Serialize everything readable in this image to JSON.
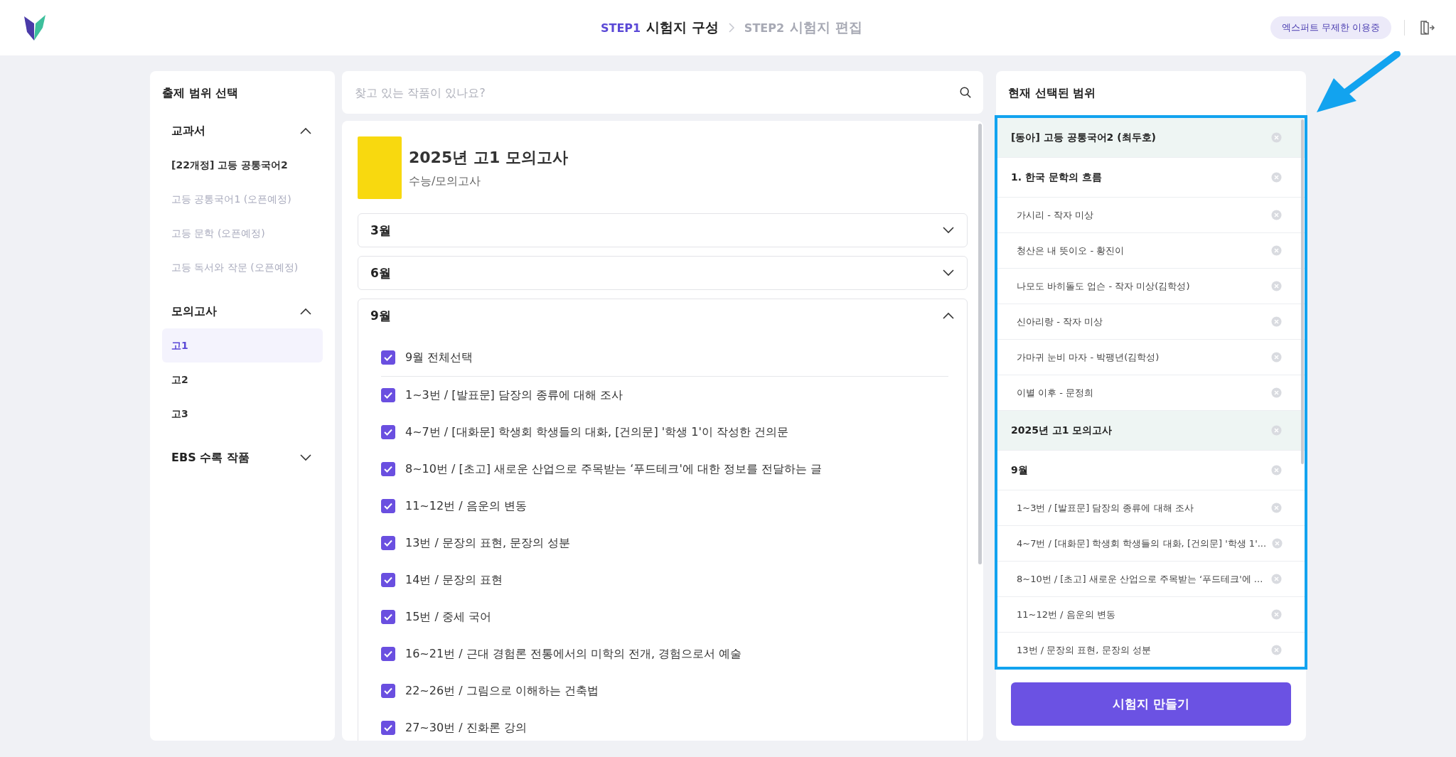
{
  "header": {
    "steps": [
      {
        "number": "STEP1",
        "label": "시험지 구성",
        "selected": true
      },
      {
        "number": "STEP2",
        "label": "시험지 편집",
        "selected": false
      }
    ],
    "badge": "엑스퍼트 무제한 이용중"
  },
  "sidebar": {
    "title": "출제 범위 선택",
    "sections": [
      {
        "title": "교과서",
        "expanded": true,
        "items": [
          {
            "label": "[22개정] 고등 공통국어2",
            "disabled": false,
            "selected": false
          },
          {
            "label": "고등 공통국어1 (오픈예정)",
            "disabled": true,
            "selected": false
          },
          {
            "label": "고등 문학 (오픈예정)",
            "disabled": true,
            "selected": false
          },
          {
            "label": "고등 독서와 작문 (오픈예정)",
            "disabled": true,
            "selected": false
          }
        ]
      },
      {
        "title": "모의고사",
        "expanded": true,
        "items": [
          {
            "label": "고1",
            "disabled": false,
            "selected": true
          },
          {
            "label": "고2",
            "disabled": false,
            "selected": false
          },
          {
            "label": "고3",
            "disabled": false,
            "selected": false
          }
        ]
      },
      {
        "title": "EBS 수록 작품",
        "expanded": false
      }
    ]
  },
  "search": {
    "placeholder": "찾고 있는 작품이 있나요?"
  },
  "exam": {
    "title": "2025년 고1 모의고사",
    "subtitle": "수능/모의고사",
    "months": [
      {
        "label": "3월",
        "expanded": false
      },
      {
        "label": "6월",
        "expanded": false
      },
      {
        "label": "9월",
        "expanded": true,
        "select_all": {
          "label": "9월 전체선택",
          "checked": true
        },
        "items": [
          {
            "label": "1~3번 / [발표문] 담장의 종류에 대해 조사",
            "checked": true
          },
          {
            "label": "4~7번 / [대화문] 학생회 학생들의 대화, [건의문] '학생 1'이 작성한 건의문",
            "checked": true
          },
          {
            "label": "8~10번 / [초고] 새로운 산업으로 주목받는 ‘푸드테크'에 대한 정보를 전달하는 글",
            "checked": true
          },
          {
            "label": "11~12번 / 음운의 변동",
            "checked": true
          },
          {
            "label": "13번 / 문장의 표현, 문장의 성분",
            "checked": true
          },
          {
            "label": "14번 / 문장의 표현",
            "checked": true
          },
          {
            "label": "15번 / 중세 국어",
            "checked": true
          },
          {
            "label": "16~21번 / 근대 경험론 전통에서의 미학의 전개, 경험으로서 예술",
            "checked": true
          },
          {
            "label": "22~26번 / 그림으로 이해하는 건축법",
            "checked": true
          },
          {
            "label": "27~30번 / 진화론 강의",
            "checked": true
          }
        ]
      }
    ]
  },
  "selection": {
    "title": "현재 선택된 범위",
    "items": [
      {
        "kind": "group",
        "label": "[동아] 고등 공통국어2 (최두호)"
      },
      {
        "kind": "section",
        "label": "1. 한국 문학의 흐름"
      },
      {
        "kind": "item",
        "label": "가시리 - 작자 미상"
      },
      {
        "kind": "item",
        "label": "청산은 내 뜻이오 - 황진이"
      },
      {
        "kind": "item",
        "label": "나모도 바히돌도 업슨 - 작자 미상(김학성)"
      },
      {
        "kind": "item",
        "label": "신아리랑 - 작자 미상"
      },
      {
        "kind": "item",
        "label": "가마귀 눈비 마자 - 박팽년(김학성)"
      },
      {
        "kind": "item",
        "label": "이별 이후 - 문정희"
      },
      {
        "kind": "group",
        "label": "2025년 고1 모의고사"
      },
      {
        "kind": "section",
        "label": "9월"
      },
      {
        "kind": "item",
        "label": "1~3번 / [발표문] 담장의 종류에 대해 조사"
      },
      {
        "kind": "item",
        "label": "4~7번 / [대화문] 학생회 학생들의 대화, [건의문] '학생 1'..."
      },
      {
        "kind": "item",
        "label": "8~10번 / [초고] 새로운 산업으로 주목받는 ‘푸드테크'에 ..."
      },
      {
        "kind": "item",
        "label": "11~12번 / 음운의 변동"
      },
      {
        "kind": "item",
        "label": "13번 / 문장의 표현, 문장의 성분"
      }
    ],
    "button": "시험지 만들기"
  }
}
